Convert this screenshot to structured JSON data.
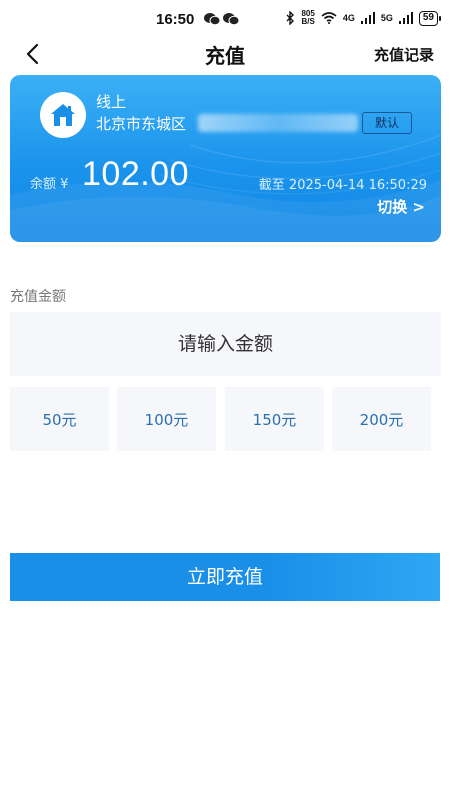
{
  "status": {
    "time": "16:50",
    "net_speed_value": "805",
    "net_speed_unit": "B/S",
    "net_4g": "4G",
    "net_5g": "5G",
    "battery": "59"
  },
  "nav": {
    "title": "充值",
    "record": "充值记录"
  },
  "card": {
    "line_type": "线上",
    "address_prefix": "北京市东城区",
    "default_label": "默认",
    "balance_label": "余额 ¥",
    "balance": "102.00",
    "as_of": "截至 2025-04-14 16:50:29",
    "switch_label": "切换 >"
  },
  "recharge": {
    "section_label": "充值金额",
    "input_placeholder": "请输入金额",
    "presets": [
      "50元",
      "100元",
      "150元",
      "200元"
    ],
    "submit_label": "立即充值"
  },
  "colors": {
    "accent": "#1a8fe8",
    "preset_text": "#2a6fb0",
    "tile_bg": "#f6f7fb"
  }
}
